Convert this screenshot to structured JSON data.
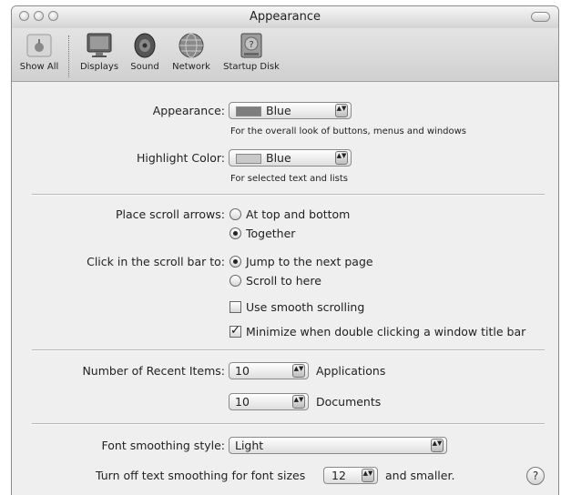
{
  "window": {
    "title": "Appearance"
  },
  "toolbar": {
    "show_all": "Show All",
    "items": [
      {
        "label": "Displays",
        "icon": "display-icon"
      },
      {
        "label": "Sound",
        "icon": "speaker-icon"
      },
      {
        "label": "Network",
        "icon": "globe-icon"
      },
      {
        "label": "Startup Disk",
        "icon": "hard-disk-icon"
      }
    ]
  },
  "appearance": {
    "label": "Appearance:",
    "value": "Blue",
    "hint": "For the overall look of buttons, menus and windows",
    "swatch_color": "#7d7d7d"
  },
  "highlight": {
    "label": "Highlight Color:",
    "value": "Blue",
    "hint": "For selected text and lists",
    "swatch_color": "#c9c9c9"
  },
  "scroll_arrows": {
    "label": "Place scroll arrows:",
    "options": [
      "At top and bottom",
      "Together"
    ],
    "selected": "Together"
  },
  "scroll_bar_click": {
    "label": "Click in the scroll bar to:",
    "options": [
      "Jump to the next page",
      "Scroll to here"
    ],
    "selected": "Jump to the next page"
  },
  "checkboxes": {
    "smooth_scrolling": {
      "label": "Use smooth scrolling",
      "checked": false
    },
    "minimize_double_click": {
      "label": "Minimize when double clicking a window title bar",
      "checked": true
    }
  },
  "recent_items": {
    "label": "Number of Recent Items:",
    "applications": {
      "value": "10",
      "label": "Applications"
    },
    "documents": {
      "value": "10",
      "label": "Documents"
    }
  },
  "font_smoothing": {
    "label": "Font smoothing style:",
    "value": "Light",
    "turn_off_prefix": "Turn off text smoothing for font sizes",
    "size_value": "12",
    "turn_off_suffix": "and smaller."
  },
  "help": {
    "label": "?"
  },
  "icons": {
    "arrows_glyph": "▲▼"
  }
}
